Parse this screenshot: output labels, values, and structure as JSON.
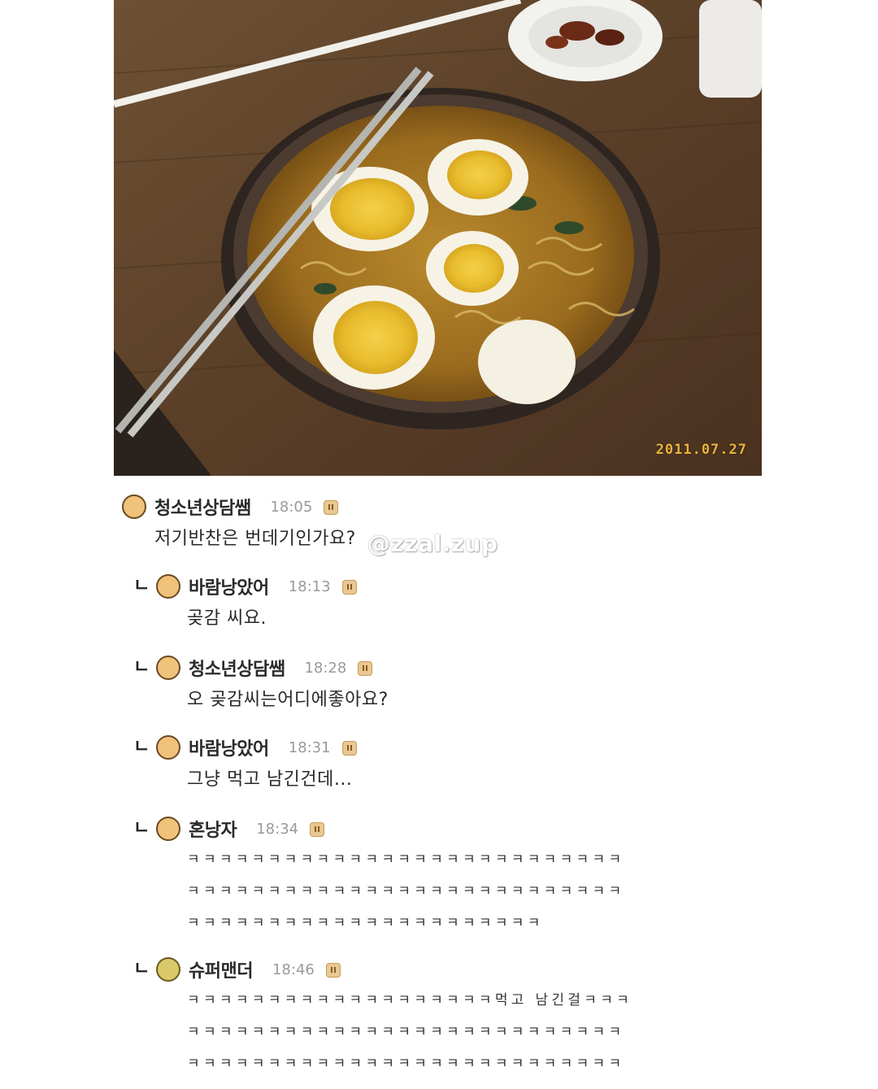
{
  "photo": {
    "date_stamp": "2011.07.27"
  },
  "watermark": "@zzal.zup",
  "comments": [
    {
      "author": "청소년상담쌤",
      "time": "18:05",
      "avatar_color": "#f0c27a",
      "text": "저기반찬은 번데기인가요?"
    },
    {
      "reply_mark": "ㄴ",
      "author": "바람낭았어",
      "time": "18:13",
      "avatar_color": "#f0c27a",
      "text": "곶감 씨요."
    },
    {
      "reply_mark": "ㄴ",
      "author": "청소년상담쌤",
      "time": "18:28",
      "avatar_color": "#f0c27a",
      "text": "오 곶감씨는어디에좋아요?"
    },
    {
      "reply_mark": "ㄴ",
      "author": "바람낭았어",
      "time": "18:31",
      "avatar_color": "#f0c27a",
      "text": "그냥 먹고 남긴건데..."
    },
    {
      "reply_mark": "ㄴ",
      "author": "혼낭자",
      "time": "18:34",
      "avatar_color": "#f0c27a",
      "lines": [
        "ㅋㅋㅋㅋㅋㅋㅋㅋㅋㅋㅋㅋㅋㅋㅋㅋㅋㅋㅋㅋㅋㅋㅋㅋㅋㅋㅋ",
        "ㅋㅋㅋㅋㅋㅋㅋㅋㅋㅋㅋㅋㅋㅋㅋㅋㅋㅋㅋㅋㅋㅋㅋㅋㅋㅋㅋ",
        "ㅋㅋㅋㅋㅋㅋㅋㅋㅋㅋㅋㅋㅋㅋㅋㅋㅋㅋㅋㅋㅋㅋ"
      ]
    },
    {
      "reply_mark": "ㄴ",
      "author": "슈퍼맨더",
      "time": "18:46",
      "avatar_color": "#d9c96a",
      "lines": [
        "ㅋㅋㅋㅋㅋㅋㅋㅋㅋㅋㅋㅋㅋㅋㅋㅋㅋㅋㅋ먹고 남긴걸ㅋㅋㅋ",
        "ㅋㅋㅋㅋㅋㅋㅋㅋㅋㅋㅋㅋㅋㅋㅋㅋㅋㅋㅋㅋㅋㅋㅋㅋㅋㅋㅋ",
        "ㅋㅋㅋㅋㅋㅋㅋㅋㅋㅋㅋㅋㅋㅋㅋㅋㅋㅋㅋㅋㅋㅋㅋㅋㅋㅋㅋ"
      ]
    }
  ]
}
